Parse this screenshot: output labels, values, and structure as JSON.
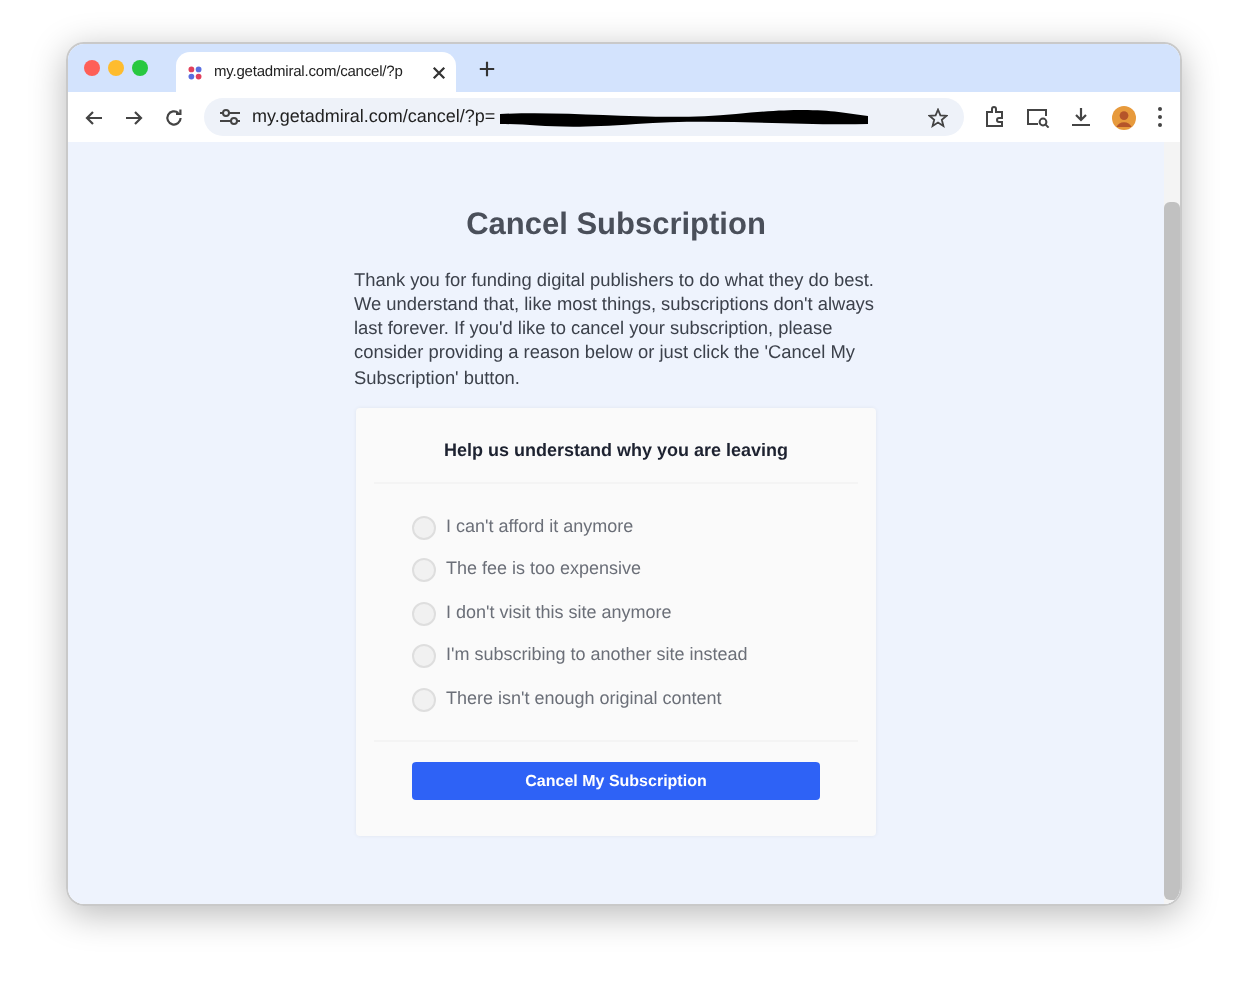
{
  "browser": {
    "tab_title": "my.getadmiral.com/cancel/?p",
    "address": "my.getadmiral.com/cancel/?p="
  },
  "page": {
    "title": "Cancel Subscription",
    "intro": "Thank you for funding digital publishers to do what they do best. We understand that, like most things, subscriptions don't always last forever. If you'd like to cancel your subscription, please consider providing a reason below or just click the 'Cancel My Subscription' button."
  },
  "form": {
    "heading": "Help us understand why you are leaving",
    "reasons": [
      {
        "label": "I can't afford it anymore",
        "selected": false
      },
      {
        "label": "The fee is too expensive",
        "selected": false
      },
      {
        "label": "I don't visit this site anymore",
        "selected": false
      },
      {
        "label": "I'm subscribing to another site instead",
        "selected": false
      },
      {
        "label": "There isn't enough original content",
        "selected": false
      }
    ],
    "submit": "Cancel My Subscription"
  }
}
